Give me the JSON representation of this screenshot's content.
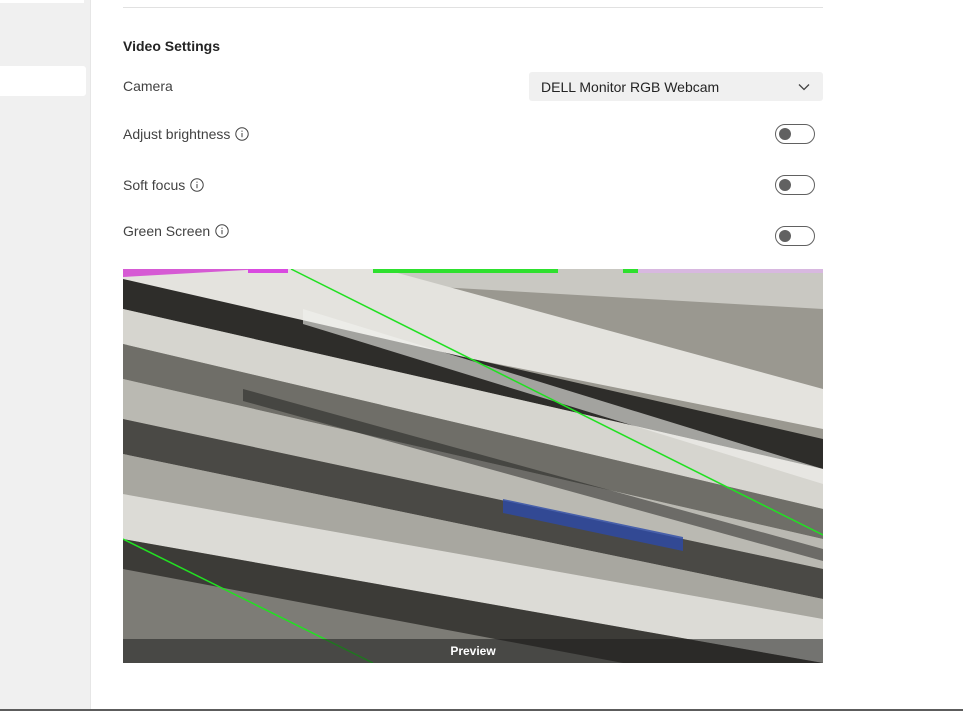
{
  "video_settings": {
    "title": "Video Settings",
    "camera": {
      "label": "Camera",
      "selected": "DELL Monitor RGB Webcam"
    },
    "adjust_brightness": {
      "label": "Adjust brightness",
      "enabled": false
    },
    "soft_focus": {
      "label": "Soft focus",
      "enabled": false
    },
    "green_screen": {
      "label": "Green Screen",
      "enabled": false
    },
    "preview": {
      "label": "Preview"
    }
  },
  "icons": {
    "info": "info-circle-icon",
    "dropdown": "chevron-down-icon"
  },
  "colors": {
    "toggle_off": "#616161",
    "dropdown_bg": "#f0f0f0",
    "nav_bg": "#f0f0f0"
  }
}
